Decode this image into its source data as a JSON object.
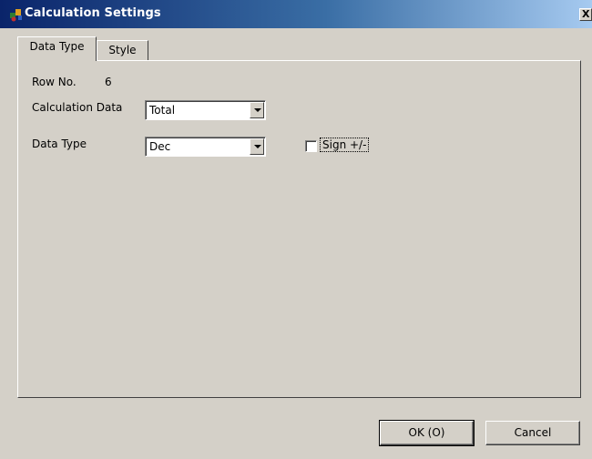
{
  "window": {
    "title": "Calculation Settings",
    "close_label": "X"
  },
  "tabs": [
    {
      "label": "Data Type",
      "active": true
    },
    {
      "label": "Style",
      "active": false
    }
  ],
  "fields": {
    "row_no": {
      "label": "Row No.",
      "value": "6"
    },
    "calculation_data": {
      "label": "Calculation Data",
      "value": "Total"
    },
    "data_type": {
      "label": "Data Type",
      "value": "Dec"
    },
    "sign": {
      "label": "Sign +/-",
      "checked": false
    }
  },
  "buttons": {
    "ok": "OK (O)",
    "cancel": "Cancel"
  },
  "icons": {
    "app": "app-icon",
    "dropdown": "chevron-down-icon"
  }
}
